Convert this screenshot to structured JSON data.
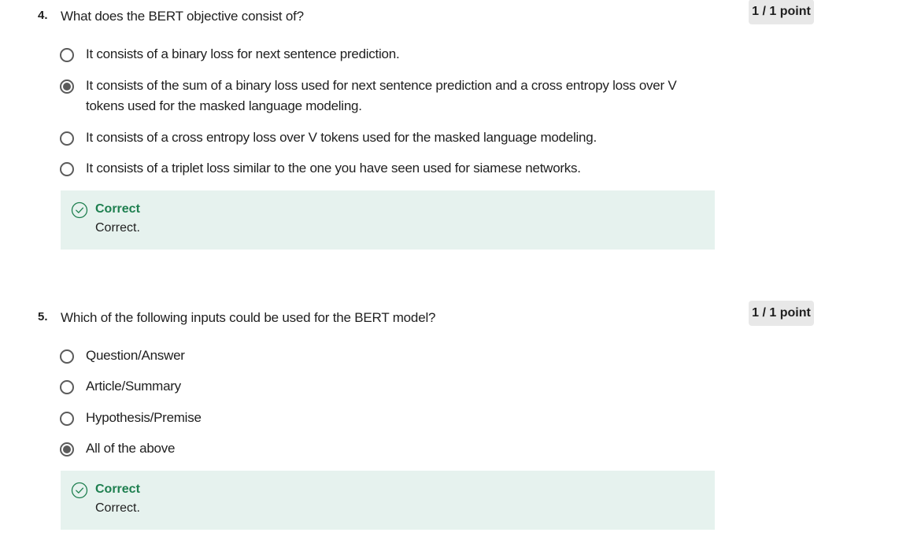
{
  "questions": [
    {
      "number": "4.",
      "text": "What does the BERT objective consist of?",
      "points": "1 / 1 point",
      "options": [
        {
          "label": "It consists of a binary loss for next sentence prediction.",
          "selected": false
        },
        {
          "label": "It consists of the sum of a binary loss used for next sentence prediction and a cross entropy loss over V tokens used for the masked language modeling.",
          "selected": true
        },
        {
          "label": "It consists of a cross entropy loss over V tokens used for the masked language modeling.",
          "selected": false
        },
        {
          "label": "It consists of a triplet loss similar to the one you have seen used for siamese networks.",
          "selected": false
        }
      ],
      "feedback": {
        "title": "Correct",
        "text": "Correct.",
        "icon": "check-circle-icon"
      }
    },
    {
      "number": "5.",
      "text": "Which of the following inputs could be used for the BERT model?",
      "points": "1 / 1 point",
      "options": [
        {
          "label": "Question/Answer",
          "selected": false
        },
        {
          "label": "Article/Summary",
          "selected": false
        },
        {
          "label": "Hypothesis/Premise",
          "selected": false
        },
        {
          "label": "All of the above",
          "selected": true
        }
      ],
      "feedback": {
        "title": "Correct",
        "text": "Correct.",
        "icon": "check-circle-icon"
      }
    }
  ],
  "colors": {
    "correct_green": "#1e7f4f",
    "feedback_bg": "#e6f2ee",
    "badge_bg": "#e8e8e8",
    "radio_gray": "#5b5b5b"
  }
}
